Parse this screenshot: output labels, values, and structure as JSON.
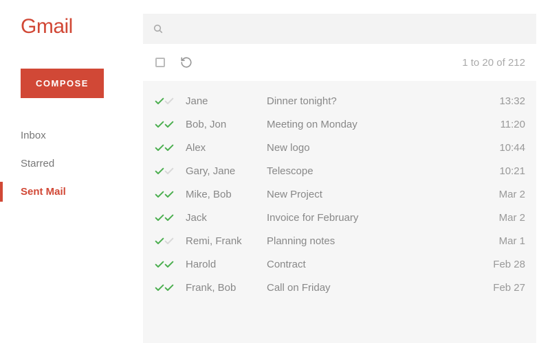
{
  "app_name": "Gmail",
  "compose_label": "COMPOSE",
  "nav": {
    "items": [
      {
        "label": "Inbox",
        "active": false
      },
      {
        "label": "Starred",
        "active": false
      },
      {
        "label": "Sent Mail",
        "active": true
      }
    ]
  },
  "search": {
    "placeholder": ""
  },
  "toolbar": {
    "range_text": "1 to 20 of 212"
  },
  "messages": [
    {
      "sender": "Jane",
      "subject": "Dinner tonight?",
      "time": "13:32",
      "read_by_all": false
    },
    {
      "sender": "Bob, Jon",
      "subject": "Meeting on Monday",
      "time": "11:20",
      "read_by_all": true
    },
    {
      "sender": "Alex",
      "subject": "New logo",
      "time": "10:44",
      "read_by_all": true
    },
    {
      "sender": "Gary, Jane",
      "subject": "Telescope",
      "time": "10:21",
      "read_by_all": false
    },
    {
      "sender": "Mike, Bob",
      "subject": "New Project",
      "time": "Mar 2",
      "read_by_all": true
    },
    {
      "sender": "Jack",
      "subject": "Invoice for February",
      "time": "Mar 2",
      "read_by_all": true
    },
    {
      "sender": "Remi, Frank",
      "subject": "Planning notes",
      "time": "Mar 1",
      "read_by_all": false
    },
    {
      "sender": "Harold",
      "subject": "Contract",
      "time": "Feb 28",
      "read_by_all": true
    },
    {
      "sender": "Frank, Bob",
      "subject": "Call on Friday",
      "time": "Feb 27",
      "read_by_all": true
    }
  ]
}
